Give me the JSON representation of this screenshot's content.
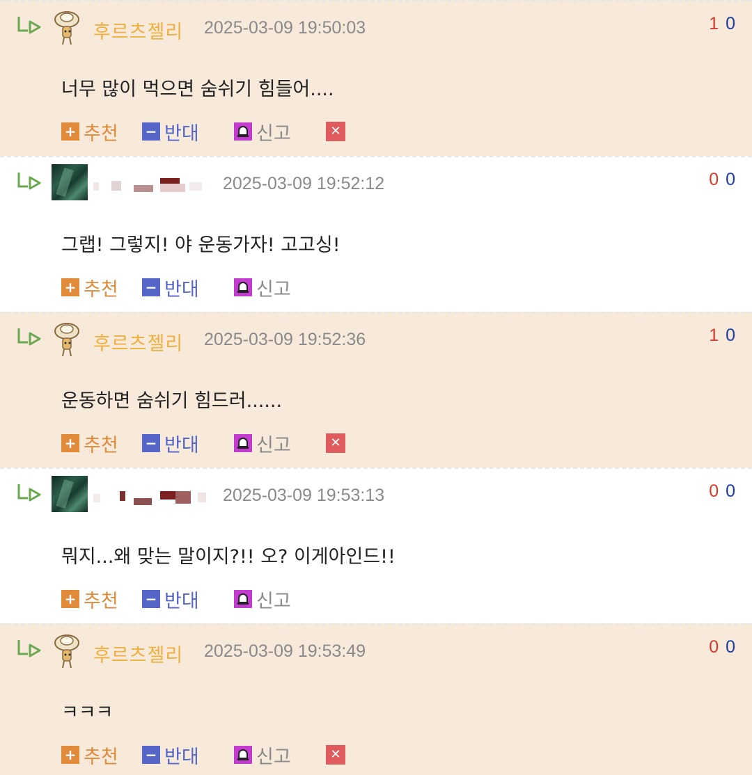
{
  "colors": {
    "op_background": "#f7eadb",
    "other_background": "#ffffff",
    "nickname": "#f0b040",
    "date": "#8a8a8a",
    "upvote": "#d33a2c",
    "downvote": "#1f3a9e",
    "recommend": "#e08a3a",
    "oppose": "#5565c8",
    "report": "#c43bd0",
    "delete": "#e05c5c"
  },
  "icons": {
    "reply": "reply-arrow-icon",
    "recommend": "plus-icon",
    "oppose": "minus-icon",
    "report": "siren-icon",
    "delete": "close-icon"
  },
  "actions": {
    "recommend_label": "추천",
    "oppose_label": "반대",
    "report_label": "신고",
    "delete_symbol": "✕"
  },
  "comments": [
    {
      "author": "후르츠젤리",
      "date": "2025-03-09 19:50:03",
      "text": "너무 많이 먹으면 숨쉬기 힘들어....",
      "up": "1",
      "down": "0"
    },
    {
      "author": "",
      "date": "2025-03-09 19:52:12",
      "text": "그랩! 그렇지! 야 운동가자! 고고싱!",
      "up": "0",
      "down": "0"
    },
    {
      "author": "후르츠젤리",
      "date": "2025-03-09 19:52:36",
      "text": "운동하면 숨쉬기 힘드러......",
      "up": "1",
      "down": "0"
    },
    {
      "author": "",
      "date": "2025-03-09 19:53:13",
      "text": "뭐지...왜 맞는 말이지?!! 오? 이게아인드!!",
      "up": "0",
      "down": "0"
    },
    {
      "author": "후르츠젤리",
      "date": "2025-03-09 19:53:49",
      "text": "ㅋㅋㅋ",
      "up": "0",
      "down": "0"
    }
  ]
}
